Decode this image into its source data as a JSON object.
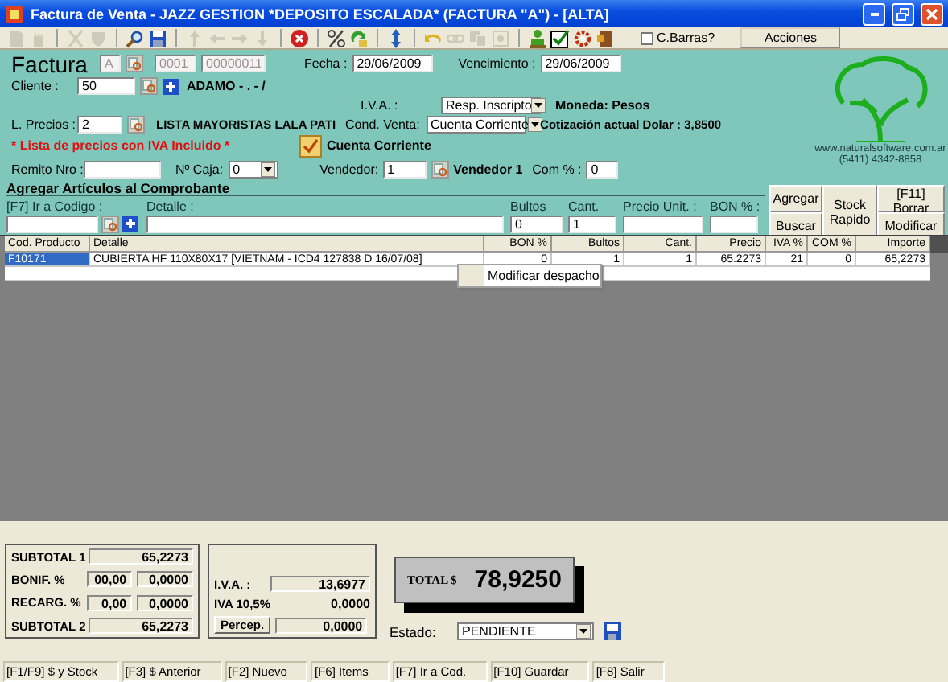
{
  "window": {
    "title": "Factura de Venta - JAZZ GESTION *DEPOSITO ESCALADA* (FACTURA \"A\") - [ALTA]"
  },
  "toolbar": {
    "groups": [
      [
        {
          "kind": "page",
          "disabled": true
        },
        {
          "kind": "hand",
          "disabled": true
        }
      ],
      [
        {
          "kind": "cut",
          "disabled": true
        },
        {
          "kind": "shield",
          "disabled": true
        }
      ],
      [
        {
          "kind": "search",
          "disabled": false
        },
        {
          "kind": "save",
          "disabled": false
        }
      ],
      [
        {
          "kind": "up",
          "disabled": true
        },
        {
          "kind": "left",
          "disabled": true
        },
        {
          "kind": "right",
          "disabled": true
        },
        {
          "kind": "down",
          "disabled": true
        }
      ],
      [
        {
          "kind": "delete",
          "disabled": false
        }
      ],
      [
        {
          "kind": "percent",
          "disabled": false
        },
        {
          "kind": "refresh",
          "disabled": false
        }
      ],
      [
        {
          "kind": "updown",
          "disabled": false
        }
      ],
      [
        {
          "kind": "undo",
          "disabled": false
        },
        {
          "kind": "link",
          "disabled": true
        },
        {
          "kind": "copy",
          "disabled": true
        },
        {
          "kind": "box",
          "disabled": true
        }
      ],
      [
        {
          "kind": "person",
          "disabled": false
        },
        {
          "kind": "checklist",
          "disabled": false
        },
        {
          "kind": "gear",
          "disabled": false
        },
        {
          "kind": "exit",
          "disabled": false
        }
      ]
    ],
    "barcode": {
      "label": "C.Barras?",
      "checked": false
    },
    "actions": "Acciones"
  },
  "header": {
    "title": "Factura",
    "letter": {
      "value": "A",
      "disabled": true
    },
    "point": {
      "value": "0001",
      "disabled": true
    },
    "number": {
      "value": "00000011",
      "disabled": true
    },
    "date_label": "Fecha :",
    "date": "29/06/2009",
    "due_label": "Vencimiento :",
    "due": "29/06/2009"
  },
  "client": {
    "label": "Cliente :",
    "value": "50",
    "name": "ADAMO - . - /"
  },
  "tax": {
    "label": "I.V.A. :",
    "value": "Resp. Inscripto"
  },
  "currency": "Moneda: Pesos",
  "price_list": {
    "label": "L. Precios :",
    "value": "2",
    "name": "LISTA MAYORISTAS LALA PATI",
    "note": "* Lista de precios con IVA Incluido *"
  },
  "sale_condition": {
    "label": "Cond. Venta:",
    "value": "Cuenta Corriente"
  },
  "exchange": "Cotización actual Dolar : 3,8500",
  "account": {
    "label": "Cuenta Corriente",
    "checked": true
  },
  "delivery": {
    "label": "Remito Nro :"
  },
  "cash_box": {
    "label": "Nº Caja:",
    "value": "0"
  },
  "seller": {
    "label": "Vendedor:",
    "value": "1",
    "name": "Vendedor 1"
  },
  "commission": {
    "label": "Com % :",
    "value": "0"
  },
  "logo": {
    "url": "www.naturalsoftware.com.ar",
    "phone": "(5411) 4342-8858"
  },
  "add_items": {
    "title": "Agregar Artículos al Comprobante",
    "fields": [
      {
        "label": "[F7] Ir a Codigo :"
      },
      {
        "label": "Detalle :"
      },
      {
        "label": "Bultos",
        "value": "0"
      },
      {
        "label": "Cant.",
        "value": "1"
      },
      {
        "label": "Precio Unit. :"
      },
      {
        "label": "BON % :"
      }
    ],
    "buttons": [
      "Agregar",
      "Stock Rapido",
      "[F11] Borrar",
      "Buscar",
      "Modificar"
    ]
  },
  "table": {
    "columns": [
      "Cod. Producto",
      "Detalle",
      "BON %",
      "Bultos",
      "Cant.",
      "Precio",
      "IVA %",
      "COM %",
      "Importe"
    ],
    "rows": [
      {
        "selected": true,
        "cells": [
          "F10171",
          "CUBIERTA HF 110X80X17 [VIETNAM - ICD4 127838 D 16/07/08]",
          "0",
          "1",
          "1",
          "65.2273",
          "21",
          "0",
          "65,2273"
        ]
      }
    ]
  },
  "context_menu": {
    "items": [
      "Modificar despacho"
    ]
  },
  "totals": {
    "subtotal1": {
      "label": "SUBTOTAL 1",
      "value": "65,2273"
    },
    "discount": {
      "label": "BONIF. %",
      "percent": "00,00",
      "amount": "0,0000"
    },
    "surcharge": {
      "label": "RECARG. %",
      "percent": "0,00",
      "amount": "0,0000"
    },
    "subtotal2": {
      "label": "SUBTOTAL 2",
      "value": "65,2273"
    },
    "vat": {
      "label": "I.V.A. :",
      "value": "13,6977"
    },
    "vat105": {
      "label": "IVA 10,5%",
      "value": "0,0000"
    },
    "perception": {
      "label": "Percep.",
      "value": "0,0000"
    },
    "total": {
      "label": "TOTAL $",
      "value": "78,9250"
    }
  },
  "status": {
    "label": "Estado:",
    "value": "PENDIENTE"
  },
  "status_bar": [
    "[F1/F9] $ y Stock",
    "[F3] $ Anterior",
    "[F2] Nuevo",
    "[F6] Items",
    "[F7] Ir a Cod.",
    "[F10] Guardar",
    "[F8] Salir"
  ]
}
